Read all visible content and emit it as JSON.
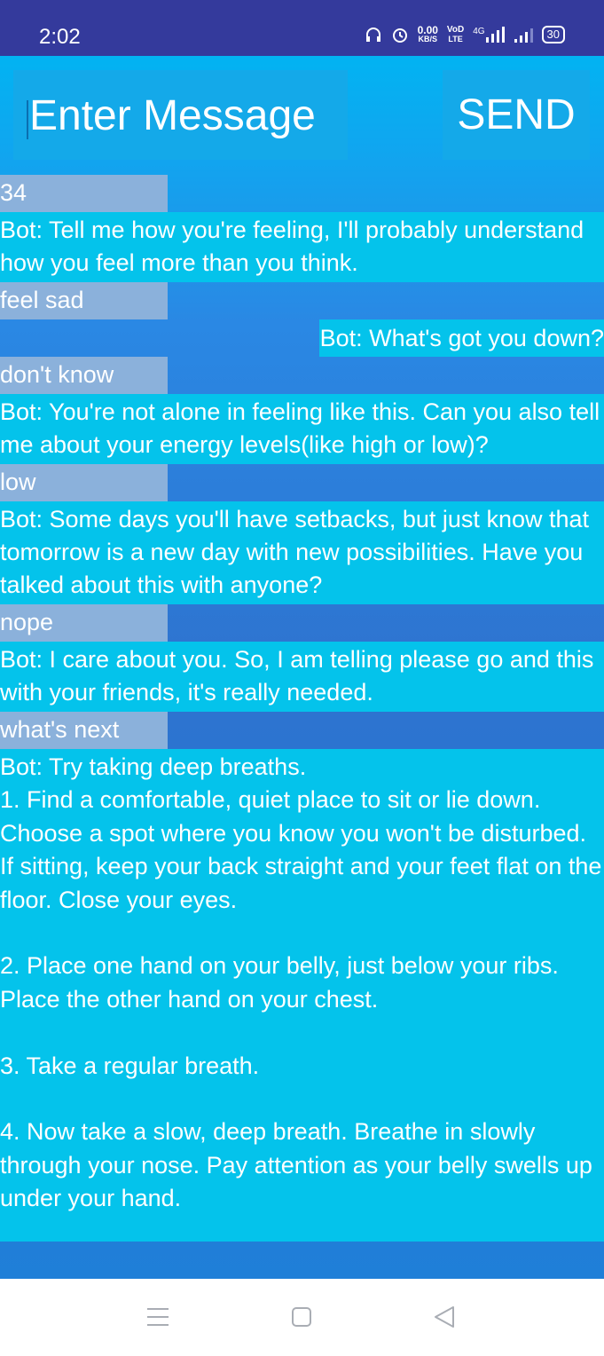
{
  "status_bar": {
    "time": "2:02",
    "net_speed_value": "0.00",
    "net_speed_unit": "KB/S",
    "volte_top": "VoD",
    "volte_bottom": "LTE",
    "network_type": "4G",
    "battery": "30"
  },
  "composer": {
    "placeholder": "Enter Message",
    "send_label": "SEND"
  },
  "messages": [
    {
      "sender": "user",
      "text": "34"
    },
    {
      "sender": "bot",
      "text": "Bot: Tell me how you're feeling, I'll probably understand how you feel more than you think."
    },
    {
      "sender": "user",
      "text": "feel sad"
    },
    {
      "sender": "bot",
      "text": "Bot: What's got you down?"
    },
    {
      "sender": "user",
      "text": "don't know"
    },
    {
      "sender": "bot",
      "text": "Bot: You're not alone in feeling like this. Can you also tell me about your energy levels(like high or low)?"
    },
    {
      "sender": "user",
      "text": "low"
    },
    {
      "sender": "bot",
      "text": "Bot: Some days you'll have setbacks, but just know that tomorrow is a new day with new possibilities. Have you talked about this with anyone?"
    },
    {
      "sender": "user",
      "text": "nope"
    },
    {
      "sender": "bot",
      "text": "Bot: I care about you. So, I am telling please go and this with your friends, it's really needed."
    },
    {
      "sender": "user",
      "text": "what's next"
    },
    {
      "sender": "bot",
      "text": "Bot: Try taking deep breaths.\n1. Find a comfortable, quiet place to sit or lie down. Choose a spot where you know you won't be disturbed. If sitting, keep your back straight and your feet flat on the floor. Close your eyes.\n\n2. Place one hand on your belly, just below your ribs. Place the other hand on your chest.\n\n3. Take a regular breath.\n\n4. Now take a slow, deep breath. Breathe in slowly through your nose. Pay attention as your belly swells up under your hand."
    }
  ],
  "colors": {
    "status_bar": "#343a9c",
    "bot_bubble": "#04c3eb",
    "user_bubble": "#8bb1db",
    "input_bg": "#14a9e9"
  },
  "icons": {
    "status": [
      "headphones-icon",
      "alarm-icon",
      "signal-icon",
      "battery-icon"
    ],
    "nav": [
      "menu-icon",
      "home-square-icon",
      "back-triangle-icon"
    ]
  }
}
